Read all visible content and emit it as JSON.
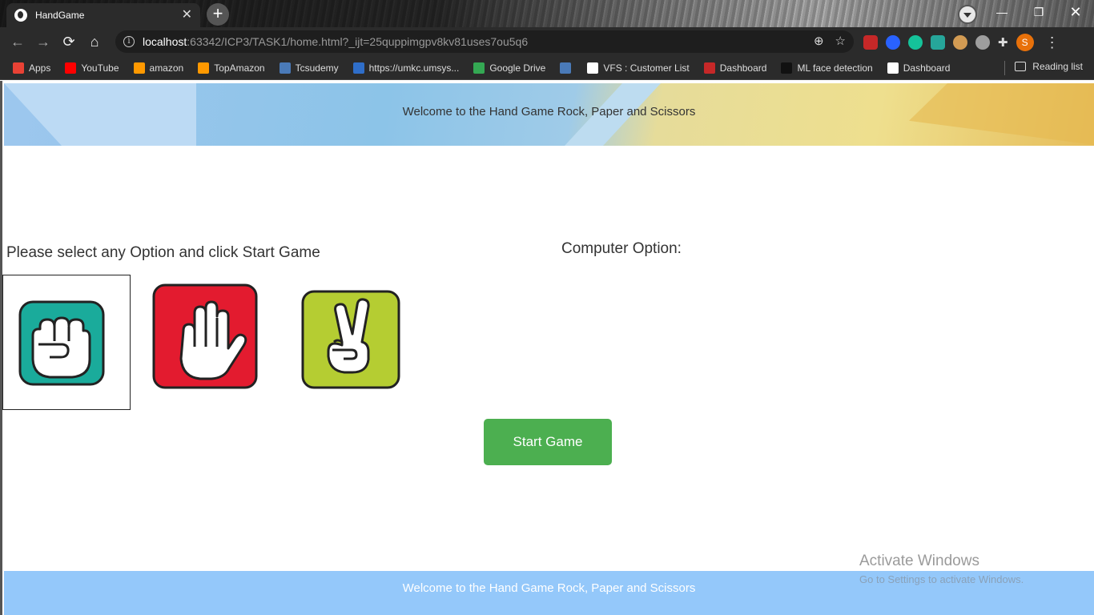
{
  "browser": {
    "tab_title": "HandGame",
    "url_host": "localhost",
    "url_rest": ":63342/ICP3/TASK1/home.html?_ijt=25quppimgpv8kv81uses7ou5q6",
    "profile_initial": "S",
    "bookmarks": [
      {
        "label": "Apps",
        "color": "#e94235"
      },
      {
        "label": "YouTube",
        "color": "#ff0000"
      },
      {
        "label": "amazon",
        "color": "#ff9900"
      },
      {
        "label": "TopAmazon",
        "color": "#ff9900"
      },
      {
        "label": "Tcsudemy",
        "color": "#4a7ab8"
      },
      {
        "label": "https://umkc.umsys...",
        "color": "#2f6ec9"
      },
      {
        "label": "Google Drive",
        "color": "#34a853"
      },
      {
        "label": "",
        "color": "#4a7ab8"
      },
      {
        "label": "VFS : Customer List",
        "color": "#ffffff"
      },
      {
        "label": "Dashboard",
        "color": "#c62828"
      },
      {
        "label": "ML face detection",
        "color": "#111111"
      },
      {
        "label": "Dashboard",
        "color": "#ffffff"
      }
    ],
    "reading_list": "Reading list"
  },
  "page": {
    "header_text": "Welcome to the Hand Game Rock, Paper and Scissors",
    "prompt": "Please select any Option and click Start Game",
    "computer_label": "Computer Option:",
    "start_button": "Start Game",
    "footer_text": "Welcome to the Hand Game Rock, Paper and Scissors",
    "options": {
      "rock_color": "#1aab9b",
      "paper_color": "#e31b2f",
      "scissors_color": "#b5cd32",
      "selected": "rock"
    }
  },
  "watermark": {
    "title": "Activate Windows",
    "subtitle": "Go to Settings to activate Windows."
  }
}
